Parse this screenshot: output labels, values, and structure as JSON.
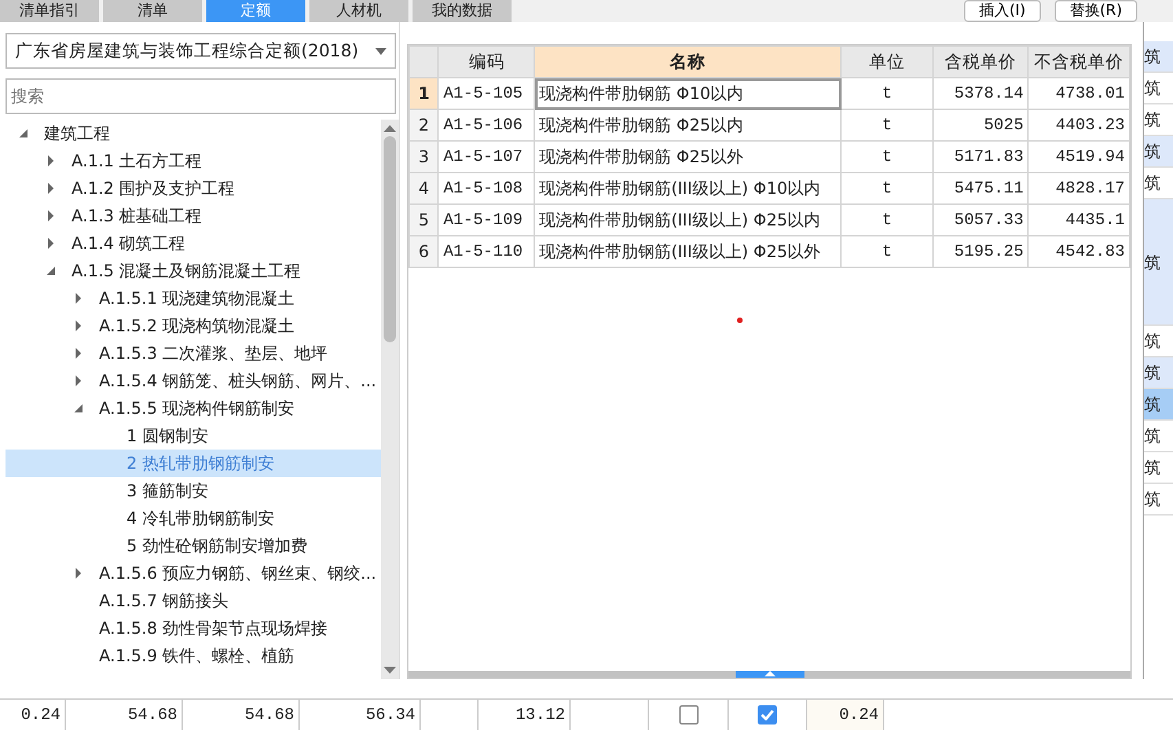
{
  "tabs": [
    {
      "label": "清单指引",
      "selected": false
    },
    {
      "label": "清单",
      "selected": false
    },
    {
      "label": "定额",
      "selected": true
    },
    {
      "label": "人材机",
      "selected": false
    },
    {
      "label": "我的数据",
      "selected": false
    }
  ],
  "toolbar_buttons": [
    "插入(I)",
    "替换(R)"
  ],
  "library_select": {
    "value": "广东省房屋建筑与装饰工程综合定额(2018)"
  },
  "search": {
    "placeholder": "搜索"
  },
  "tree": [
    {
      "label": "建筑工程",
      "kind": "branch",
      "expanded": true,
      "selected": false,
      "children": [
        {
          "label": "A.1.1 土石方工程",
          "kind": "branch",
          "expanded": false,
          "selected": false
        },
        {
          "label": "A.1.2 围护及支护工程",
          "kind": "branch",
          "expanded": false,
          "selected": false
        },
        {
          "label": "A.1.3 桩基础工程",
          "kind": "branch",
          "expanded": false,
          "selected": false
        },
        {
          "label": "A.1.4 砌筑工程",
          "kind": "branch",
          "expanded": false,
          "selected": false
        },
        {
          "label": "A.1.5 混凝土及钢筋混凝土工程",
          "kind": "branch",
          "expanded": true,
          "selected": false,
          "children": [
            {
              "label": "A.1.5.1 现浇建筑物混凝土",
              "kind": "branch",
              "expanded": false,
              "selected": false
            },
            {
              "label": "A.1.5.2 现浇构筑物混凝土",
              "kind": "branch",
              "expanded": false,
              "selected": false
            },
            {
              "label": "A.1.5.3 二次灌浆、垫层、地坪",
              "kind": "branch",
              "expanded": false,
              "selected": false
            },
            {
              "label": "A.1.5.4 钢筋笼、桩头钢筋、网片、...",
              "kind": "branch",
              "expanded": false,
              "selected": false
            },
            {
              "label": "A.1.5.5 现浇构件钢筋制安",
              "kind": "branch",
              "expanded": true,
              "selected": false,
              "children": [
                {
                  "label": "1 圆钢制安",
                  "kind": "leaf",
                  "selected": false
                },
                {
                  "label": "2 热轧带肋钢筋制安",
                  "kind": "leaf",
                  "selected": true
                },
                {
                  "label": "3 箍筋制安",
                  "kind": "leaf",
                  "selected": false
                },
                {
                  "label": "4 冷轧带肋钢筋制安",
                  "kind": "leaf",
                  "selected": false
                },
                {
                  "label": "5 劲性砼钢筋制安增加费",
                  "kind": "leaf",
                  "selected": false
                }
              ]
            },
            {
              "label": "A.1.5.6 预应力钢筋、钢丝束、钢绞...",
              "kind": "branch",
              "expanded": false,
              "selected": false
            },
            {
              "label": "A.1.5.7 钢筋接头",
              "kind": "leaf",
              "selected": false
            },
            {
              "label": "A.1.5.8 劲性骨架节点现场焊接",
              "kind": "leaf",
              "selected": false
            },
            {
              "label": "A.1.5.9 铁件、螺栓、植筋",
              "kind": "leaf",
              "selected": false
            }
          ]
        }
      ]
    }
  ],
  "table": {
    "columns": [
      {
        "label": "编码",
        "selected": false
      },
      {
        "label": "名称",
        "selected": true
      },
      {
        "label": "单位",
        "selected": false
      },
      {
        "label": "含税单价",
        "selected": false
      },
      {
        "label": "不含税单价",
        "selected": false
      }
    ],
    "rows": [
      {
        "no": "1",
        "selected": true,
        "cells": [
          "A1-5-105",
          "现浇构件带肋钢筋 Φ10以内",
          "t",
          "5378.14",
          "4738.01"
        ]
      },
      {
        "no": "2",
        "selected": false,
        "cells": [
          "A1-5-106",
          "现浇构件带肋钢筋 Φ25以内",
          "t",
          "5025",
          "4403.23"
        ]
      },
      {
        "no": "3",
        "selected": false,
        "cells": [
          "A1-5-107",
          "现浇构件带肋钢筋 Φ25以外",
          "t",
          "5171.83",
          "4519.94"
        ]
      },
      {
        "no": "4",
        "selected": false,
        "cells": [
          "A1-5-108",
          "现浇构件带肋钢筋(III级以上) Φ10以内",
          "t",
          "5475.11",
          "4828.17"
        ]
      },
      {
        "no": "5",
        "selected": false,
        "cells": [
          "A1-5-109",
          "现浇构件带肋钢筋(III级以上) Φ25以内",
          "t",
          "5057.33",
          "4435.1"
        ]
      },
      {
        "no": "6",
        "selected": false,
        "cells": [
          "A1-5-110",
          "现浇构件带肋钢筋(III级以上) Φ25以外",
          "t",
          "5195.25",
          "4542.83"
        ]
      }
    ]
  },
  "side_column": [
    {
      "text": "筑",
      "kind": "alt"
    },
    {
      "text": "筑",
      "kind": "plain"
    },
    {
      "text": "筑",
      "kind": "plain"
    },
    {
      "text": "筑",
      "kind": "alt"
    },
    {
      "text": "筑",
      "kind": "plain"
    },
    {
      "text": "筑",
      "kind": "tall"
    },
    {
      "text": "筑",
      "kind": "plain"
    },
    {
      "text": "筑",
      "kind": "alt"
    },
    {
      "text": "筑",
      "kind": "selected"
    },
    {
      "text": "筑",
      "kind": "plain"
    },
    {
      "text": "筑",
      "kind": "plain"
    },
    {
      "text": "筑",
      "kind": "plain"
    }
  ],
  "bottom_row": [
    {
      "kind": "text",
      "text": "0.24"
    },
    {
      "kind": "text",
      "text": "54.68"
    },
    {
      "kind": "text",
      "text": "54.68"
    },
    {
      "kind": "text",
      "text": "56.34"
    },
    {
      "kind": "empty"
    },
    {
      "kind": "text",
      "text": "13.12"
    },
    {
      "kind": "empty"
    },
    {
      "kind": "checkbox",
      "checked": false
    },
    {
      "kind": "checkbox",
      "checked": true
    },
    {
      "kind": "text",
      "text": "0.24",
      "highlight": true
    }
  ]
}
